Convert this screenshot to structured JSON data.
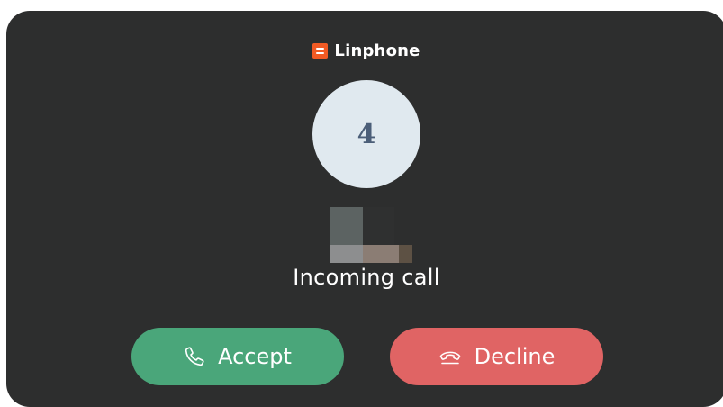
{
  "app": {
    "name": "Linphone",
    "brand_color": "#f15a24",
    "icon": "linphone-logo-icon"
  },
  "caller": {
    "avatar_initial": "4",
    "avatar_bg": "#e0e9ef",
    "name_redacted": true
  },
  "call": {
    "status": "Incoming call"
  },
  "actions": {
    "accept_label": "Accept",
    "accept_icon": "phone-icon",
    "accept_color": "#4aa67a",
    "decline_label": "Decline",
    "decline_icon": "hang-up-icon",
    "decline_color": "#e06464"
  },
  "theme": {
    "card_bg": "#2d2e2e",
    "text": "#ffffff"
  }
}
